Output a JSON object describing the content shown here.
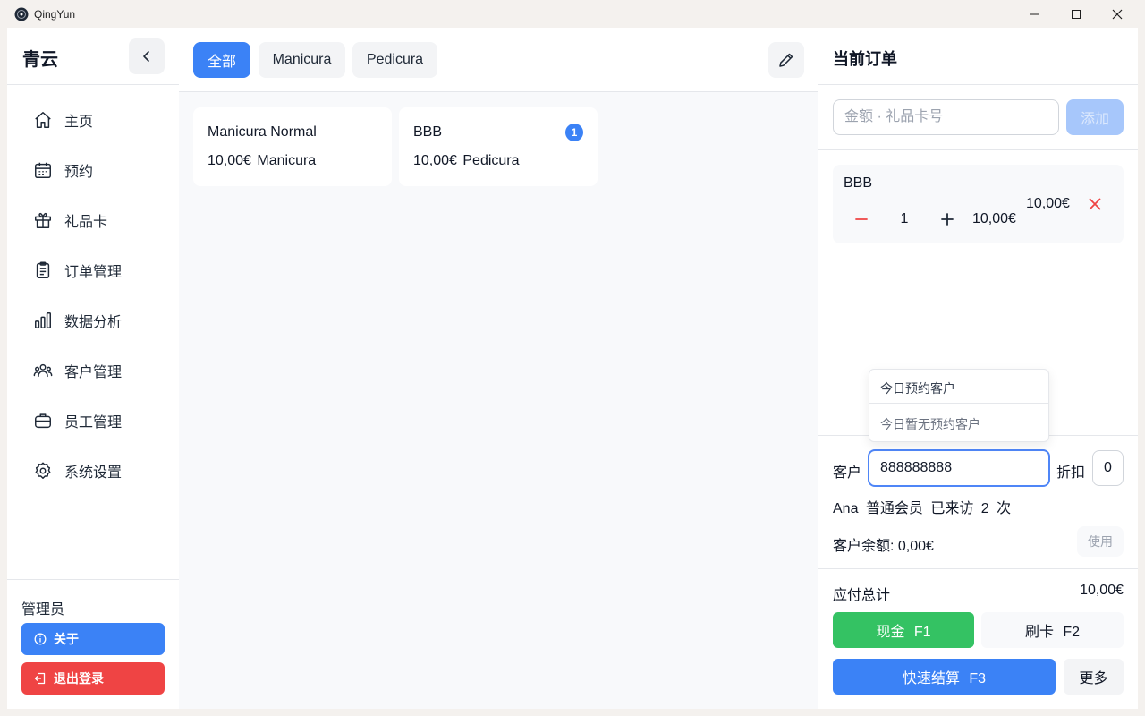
{
  "window": {
    "title": "QingYun"
  },
  "sidebar": {
    "brand": "青云",
    "items": [
      {
        "label": "主页",
        "icon": "home-icon"
      },
      {
        "label": "预约",
        "icon": "calendar-icon"
      },
      {
        "label": "礼品卡",
        "icon": "gift-icon"
      },
      {
        "label": "订单管理",
        "icon": "clipboard-icon"
      },
      {
        "label": "数据分析",
        "icon": "bar-chart-icon"
      },
      {
        "label": "客户管理",
        "icon": "users-icon"
      },
      {
        "label": "员工管理",
        "icon": "briefcase-icon"
      },
      {
        "label": "系统设置",
        "icon": "gear-icon"
      }
    ],
    "role": "管理员",
    "about_label": "关于",
    "logout_label": "退出登录"
  },
  "main": {
    "tabs": [
      {
        "label": "全部",
        "active": true
      },
      {
        "label": "Manicura",
        "active": false
      },
      {
        "label": "Pedicura",
        "active": false
      }
    ],
    "services": [
      {
        "name": "Manicura Normal",
        "meta": "10,00€ Manicura",
        "badge": ""
      },
      {
        "name": "BBB",
        "meta": "10,00€ Pedicura",
        "badge": "1"
      }
    ]
  },
  "order": {
    "title": "当前订单",
    "gift_placeholder": "金额 · 礼品卡号",
    "add_label": "添加",
    "item": {
      "name": "BBB",
      "qty": "1",
      "unit_price": "10,00€",
      "total": "10,00€"
    },
    "popup": {
      "heading": "今日预约客户",
      "empty": "今日暂无预约客户"
    },
    "customer_label": "客户",
    "customer_value": "888888888",
    "discount_label": "折扣",
    "discount_value": "0",
    "customer_info": "Ana 普通会员 已来访 2 次",
    "balance": "客户余额: 0,00€",
    "use_label": "使用",
    "total_label": "应付总计",
    "total_value": "10,00€",
    "cash_label": "现金 F1",
    "card_label": "刷卡 F2",
    "quick_label": "快速结算 F3",
    "more_label": "更多"
  },
  "colors": {
    "accent": "#3b82f6",
    "success": "#34c263",
    "danger": "#ef4444"
  }
}
